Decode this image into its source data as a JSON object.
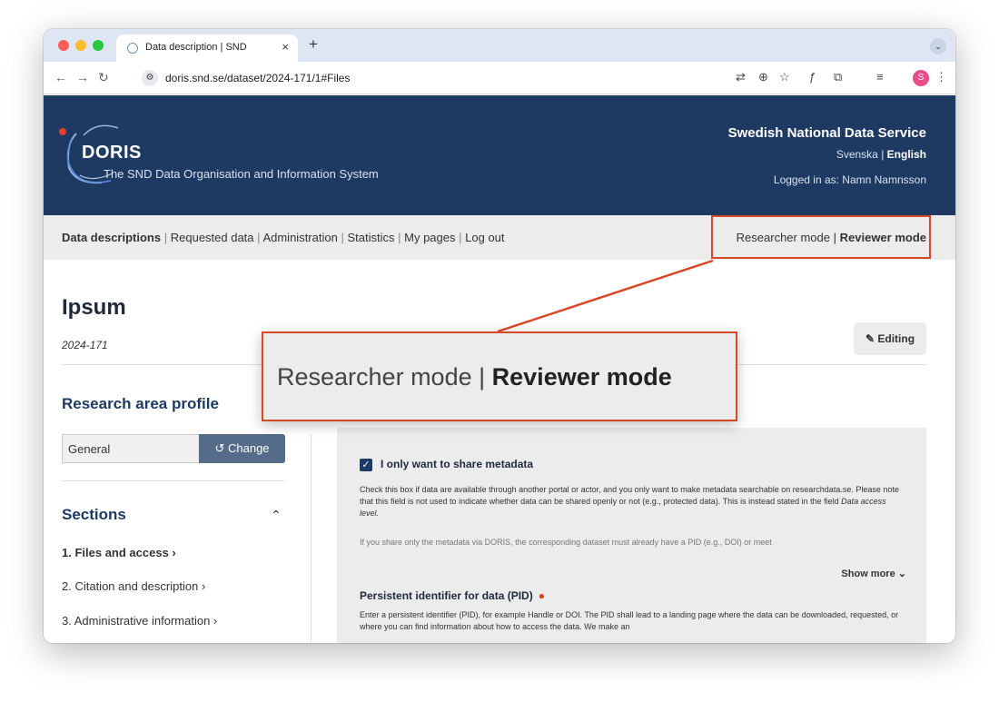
{
  "browser": {
    "tab_title": "Data description | SND",
    "tab_close": "×",
    "new_tab": "+",
    "url": "doris.snd.se/dataset/2024-171/1#Files",
    "profile_initial": "S"
  },
  "header": {
    "logo_text": "DORIS",
    "logo_subtitle": "The SND Data Organisation and Information System",
    "org_name": "Swedish National Data Service",
    "lang_sv": "Svenska",
    "lang_sep": "|",
    "lang_en": "English",
    "logged_in": "Logged in as: Namn Namnsson"
  },
  "menu": {
    "items": [
      "Data descriptions",
      "Requested data",
      "Administration",
      "Statistics",
      "My pages",
      "Log out"
    ],
    "separator": "|"
  },
  "modes": {
    "researcher": "Researcher mode",
    "separator": "|",
    "reviewer": "Reviewer mode"
  },
  "dataset": {
    "title": "Ipsum",
    "id": "2024-171",
    "editing_label": "Editing"
  },
  "sidebar": {
    "research_area_title": "Research area profile",
    "profile_value": "General",
    "change_label": "Change",
    "sections_title": "Sections",
    "sections": [
      "1. Files and access",
      "2. Citation and description",
      "3. Administrative information"
    ]
  },
  "main": {
    "checkbox_label": "I only want to share metadata",
    "paragraph1": "Check this box if data are available through another portal or actor, and you only want to make metadata searchable on researchdata.se. Please note that this field is not used to indicate whether data can be shared openly or not (e.g., protected data). This is instead stated in the field ",
    "paragraph1_em": "Data access level.",
    "paragraph2": "If you share only the metadata via DORIS, the corresponding dataset must already have a PID (e.g., DOI) or meet",
    "show_more": "Show more",
    "pid_title": "Persistent identifier for data (PID)",
    "paragraph3": "Enter a persistent identifier (PID), for example Handle or DOI. The PID shall lead to a landing page where the data can be downloaded, requested, or where you can find information about how to access the data. We make an"
  },
  "callout": {
    "researcher": "Researcher mode",
    "separator": "|",
    "reviewer": "Reviewer mode"
  },
  "colors": {
    "header_bg": "#1e3a63",
    "highlight": "#d9472b",
    "button_bg": "#556b8a"
  }
}
